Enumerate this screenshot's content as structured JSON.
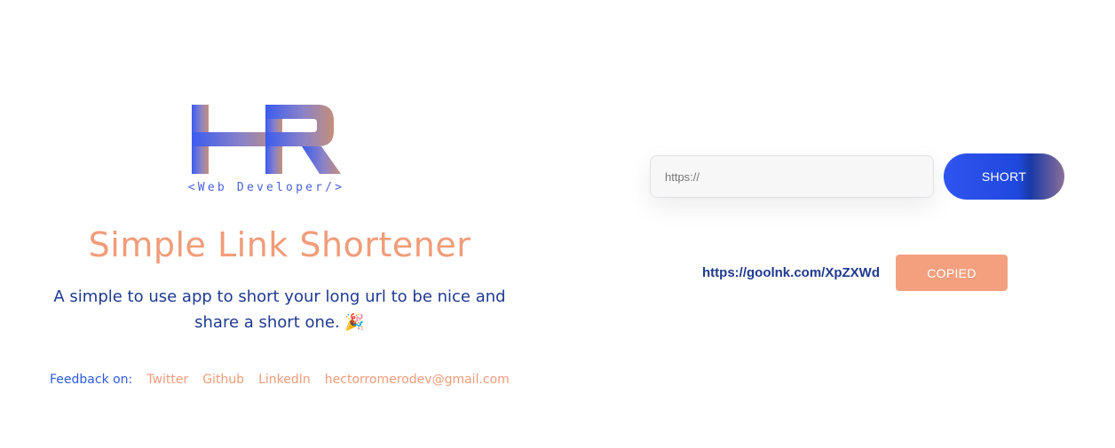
{
  "brand": {
    "logo_text": "HR",
    "tagline": "<Web Developer/>",
    "gradient_start": "#3b5cf0",
    "gradient_end": "#c58f7a"
  },
  "hero": {
    "title": "Simple Link Shortener",
    "subtitle": "A simple to use app to short your long url to be nice and share a short one. 🎉"
  },
  "feedback": {
    "label": "Feedback on:",
    "links": [
      {
        "label": "Twitter"
      },
      {
        "label": "Github"
      },
      {
        "label": "LinkedIn"
      },
      {
        "label": "hectorromerodev@gmail.com"
      }
    ]
  },
  "shortener": {
    "input_placeholder": "https://",
    "input_value": "",
    "short_button_label": "SHORT",
    "result_url": "https://goolnk.com/XpZXWd",
    "copy_button_label": "COPIED"
  },
  "colors": {
    "accent_orange": "#f19c79",
    "primary_blue": "#2f55f0",
    "navy_text": "#1f3a8f"
  }
}
